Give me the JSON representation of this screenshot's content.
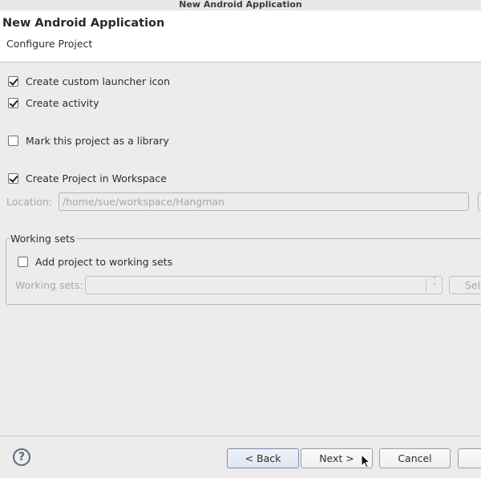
{
  "window": {
    "title": "New Android Application"
  },
  "header": {
    "title": "New Android Application",
    "subtitle": "Configure Project"
  },
  "options": [
    {
      "label": "Create custom launcher icon",
      "checked": true
    },
    {
      "label": "Create activity",
      "checked": true
    },
    {
      "label": "Mark this project as a library",
      "checked": false
    },
    {
      "label": "Create Project in Workspace",
      "checked": true
    }
  ],
  "location": {
    "label": "Location:",
    "value": "/home/sue/workspace/Hangman"
  },
  "working_sets": {
    "group_title": "Working sets",
    "add_label": "Add project to working sets",
    "add_checked": false,
    "field_label": "Working sets:",
    "value": "",
    "select_button": "Sel"
  },
  "footer": {
    "help_icon": "help-icon",
    "back": "< Back",
    "next": "Next >",
    "cancel": "Cancel",
    "finish": ""
  }
}
